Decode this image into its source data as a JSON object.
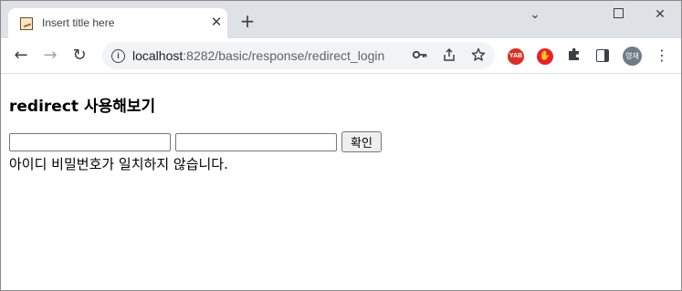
{
  "browser": {
    "tab": {
      "title": "Insert title here",
      "close_glyph": "✕"
    },
    "new_tab_glyph": "+",
    "window_controls": {
      "minimize_glyph": "⌄",
      "close_glyph": "✕"
    },
    "nav": {
      "back_glyph": "←",
      "forward_glyph": "→",
      "reload_glyph": "↻"
    },
    "url": {
      "host": "localhost",
      "path": ":8282/basic/response/redirect_login"
    },
    "icons": {
      "info": "info-icon",
      "key": "key-icon",
      "share": "share-icon",
      "star": "star-icon",
      "extensions": "puzzle-icon",
      "side_panel": "side-panel-icon",
      "menu": "kebab-menu-icon"
    },
    "extensions": [
      {
        "label": "YAB",
        "color": "#d93025"
      },
      {
        "label": "✋",
        "color": "#e8202a"
      }
    ],
    "profile": {
      "label": "영재",
      "color": "#6c7d87"
    }
  },
  "page": {
    "heading": "redirect 사용해보기",
    "form": {
      "id_value": "",
      "password_value": "",
      "submit_label": "확인"
    },
    "message": "아이디 비밀번호가 일치하지 않습니다."
  }
}
